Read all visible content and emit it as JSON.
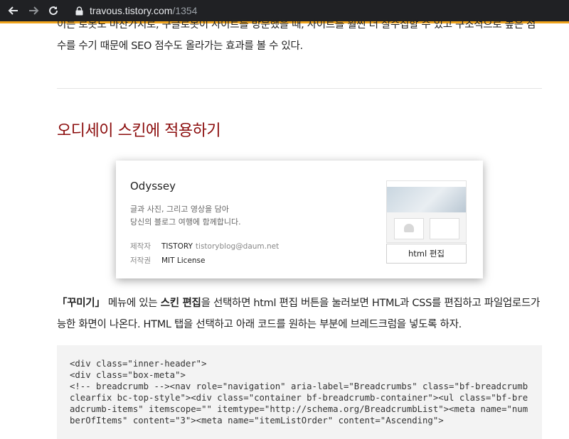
{
  "browser": {
    "back_icon": "arrow-left-icon",
    "forward_icon": "arrow-right-icon",
    "reload_icon": "reload-icon",
    "lock_icon": "lock-icon",
    "url_host": "travous.tistory.com",
    "url_path": "/1354",
    "accent_color": "#f0a41d"
  },
  "article": {
    "intro_text": "이는 로봇도 마찬가지로, 구글로봇이 사이트를 방문했을 때, 사이트를 훨씬 더 잘수집할 수 있고 구조적으로 높은 점수를 수기 때문에 SEO 점수도 올라가는 효과를 볼 수 있다.",
    "heading": "오디세이 스킨에 적용하기",
    "heading_color": "#8b0c0c",
    "skin_card": {
      "name": "Odyssey",
      "desc_line1": "글과 사진, 그리고 영상을 담아",
      "desc_line2": "당신의 블로그 여행에 함께합니다.",
      "maker_label": "제작자",
      "maker_value": "TISTORY",
      "maker_email": "tistoryblog@daum.net",
      "license_label": "저작권",
      "license_value": "MIT License",
      "button_label": "html 편집"
    },
    "para2": {
      "p1": "「꾸미기」",
      "p2": " 메뉴에 있는 ",
      "p3": "스킨 편집",
      "p4": "을 선택하면 html 편집 버튼을 눌러보면 HTML과 CSS를 편집하고 파일업로드가능한 화면이 나온다. HTML 탭을 선택하고 아래 코드를 원하는 부분에 브레드크럼을 넣도록 하자."
    },
    "code": "<div class=\"inner-header\">\n<div class=\"box-meta\">\n<!-- breadcrumb --><nav role=\"navigation\" aria-label=\"Breadcrumbs\" class=\"bf-breadcrumb clearfix bc-top-style\"><div class=\"container bf-breadcrumb-container\"><ul class=\"bf-breadcrumb-items\" itemscope=\"\" itemtype=\"http://schema.org/BreadcrumbList\"><meta name=\"numberOfItems\" content=\"3\"><meta name=\"itemListOrder\" content=\"Ascending\">"
  }
}
